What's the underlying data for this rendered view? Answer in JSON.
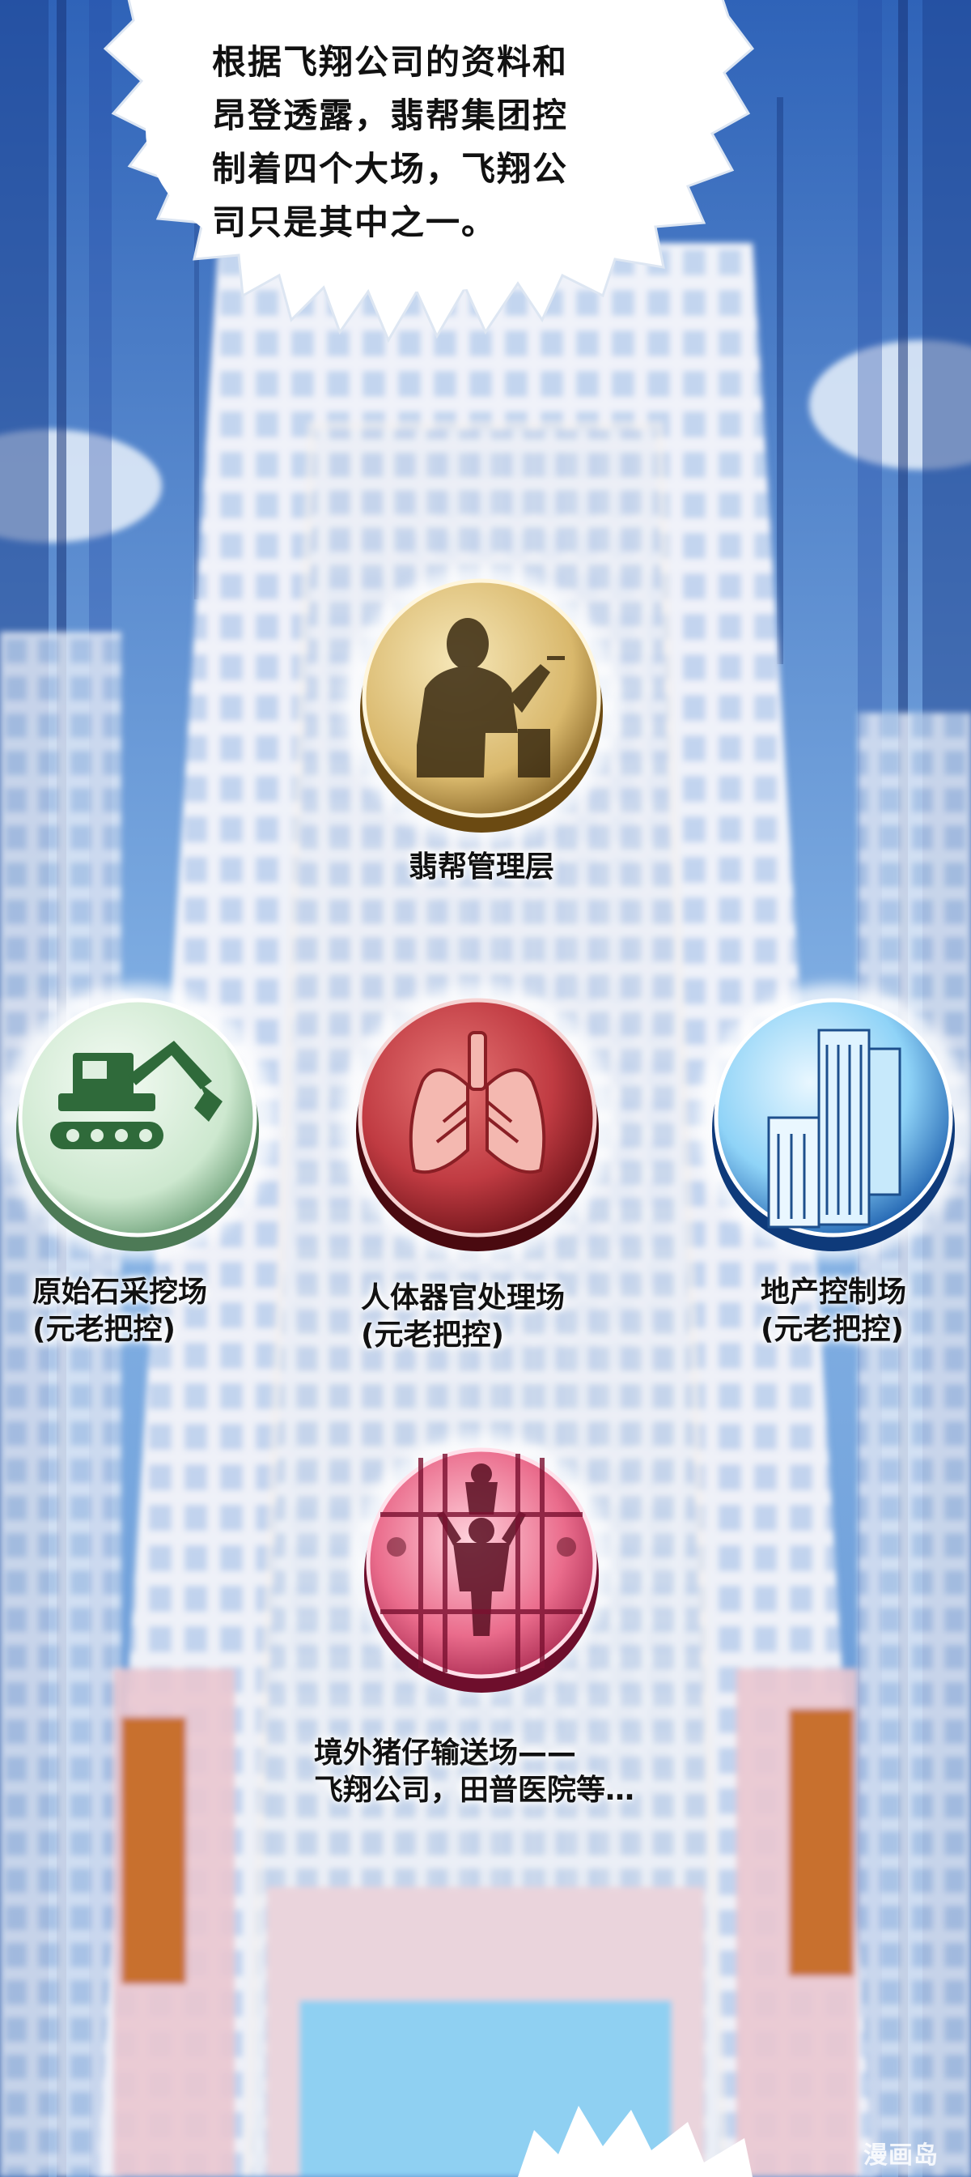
{
  "speech_bubble": {
    "lines": [
      "根据飞翔公司的资料和",
      "昂登透露，翡帮集团控",
      "制着四个大场，飞翔公",
      "司只是其中之一。"
    ]
  },
  "nodes": {
    "management": {
      "label": "翡帮管理层",
      "icon": "businessman-silhouette-icon"
    },
    "mining": {
      "line1": "原始石采挖场",
      "line2": "(元老把控)",
      "icon": "excavator-icon"
    },
    "organ": {
      "line1": "人体器官处理场",
      "line2": "(元老把控)",
      "icon": "lungs-icon"
    },
    "realestate": {
      "line1": "地产控制场",
      "line2": "(元老把控)",
      "icon": "skyscraper-icon"
    },
    "smuggling": {
      "line1": "境外猪仔输送场——",
      "line2": "飞翔公司，田普医院等…",
      "icon": "prisoners-behind-bars-icon"
    }
  },
  "watermark": "漫画岛",
  "colors": {
    "gold": "#c9a85c",
    "green": "#bfe3c6",
    "red": "#b8323a",
    "blue": "#2f8fd6",
    "pink": "#e24a78"
  }
}
